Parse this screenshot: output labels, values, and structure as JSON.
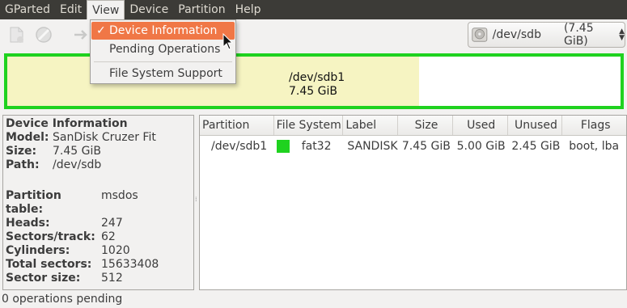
{
  "menubar": {
    "items": [
      "GParted",
      "Edit",
      "View",
      "Device",
      "Partition",
      "Help"
    ]
  },
  "view_menu": {
    "items": [
      {
        "label": "Device Information",
        "checked": true
      },
      {
        "label": "Pending Operations",
        "checked": false
      },
      {
        "label": "File System Support",
        "checked": false
      }
    ],
    "check_glyph": "✓"
  },
  "toolbar": {
    "icons": [
      "new-partition-icon",
      "delete-icon",
      "resize-move-icon"
    ]
  },
  "device_selector": {
    "device": "/dev/sdb",
    "size": "(7.45 GiB)",
    "icon": "disk-icon"
  },
  "partition_graph": {
    "name": "/dev/sdb1",
    "size": "7.45 GiB",
    "used_fraction": 0.671,
    "border_color": "#1fd21f",
    "used_color": "#f6f4c2"
  },
  "device_info": {
    "title": "Device Information",
    "model_label": "Model:",
    "model": "SanDisk Cruzer Fit",
    "size_label": "Size:",
    "size": "7.45 GiB",
    "path_label": "Path:",
    "path": "/dev/sdb",
    "partition_table_label": "Partition table:",
    "partition_table": "msdos",
    "heads_label": "Heads:",
    "heads": "247",
    "sectors_track_label": "Sectors/track:",
    "sectors_track": "62",
    "cylinders_label": "Cylinders:",
    "cylinders": "1020",
    "total_sectors_label": "Total sectors:",
    "total_sectors": "15633408",
    "sector_size_label": "Sector size:",
    "sector_size": "512"
  },
  "table": {
    "headers": [
      "Partition",
      "File System",
      "Label",
      "Size",
      "Used",
      "Unused",
      "Flags"
    ],
    "rows": [
      {
        "partition": "/dev/sdb1",
        "fs": "fat32",
        "fs_color": "#1fd21f",
        "label": "SANDISK",
        "size": "7.45 GiB",
        "used": "5.00 GiB",
        "unused": "2.45 GiB",
        "flags": "boot, lba"
      }
    ]
  },
  "status": {
    "text": "0 operations pending"
  }
}
